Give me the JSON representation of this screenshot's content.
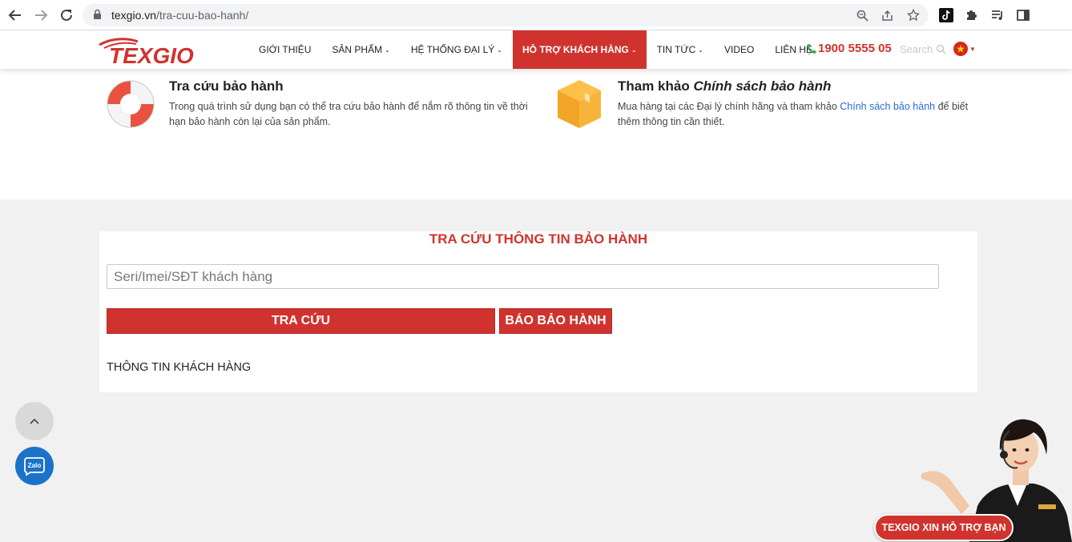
{
  "browser": {
    "url_domain": "texgio.vn",
    "url_path": "/tra-cuu-bao-hanh/"
  },
  "header": {
    "logo_text": "TEXGIO",
    "menu": [
      {
        "label": "GIỚI THIỆU",
        "has_dropdown": false,
        "active": false
      },
      {
        "label": "SẢN PHẨM",
        "has_dropdown": true,
        "active": false
      },
      {
        "label": "HỆ THỐNG ĐẠI LÝ",
        "has_dropdown": true,
        "active": false
      },
      {
        "label": "HỖ TRỢ KHÁCH HÀNG",
        "has_dropdown": true,
        "active": true
      },
      {
        "label": "TIN TỨC",
        "has_dropdown": true,
        "active": false
      },
      {
        "label": "VIDEO",
        "has_dropdown": false,
        "active": false
      },
      {
        "label": "LIÊN HỆ",
        "has_dropdown": false,
        "active": false
      }
    ],
    "hotline": "1900 5555 05",
    "search_placeholder": "Search"
  },
  "info": {
    "lookup": {
      "title": "Tra cứu bảo hành",
      "description": "Trong quá trình sử dụng bạn có thể tra cứu bảo hành để nắm rõ thông tin về thời hạn bảo hành còn lại của sản phẩm."
    },
    "policy": {
      "title_prefix": "Tham khảo ",
      "title_italic": "Chính sách bảo hành",
      "description_before": "Mua hàng tại các Đại lý chính hãng và tham khảo ",
      "description_link": "Chính sách bảo hành",
      "description_after": " để biết thêm thông tin cần thiết."
    }
  },
  "form": {
    "title": "TRA CỨU THÔNG TIN BẢO HÀNH",
    "input_placeholder": "Seri/Imei/SĐT khách hàng",
    "input_value": "",
    "lookup_button": "TRA CỨU",
    "report_button": "BÁO BẢO HÀNH",
    "customer_info_label": "THÔNG TIN KHÁCH HÀNG"
  },
  "widgets": {
    "zalo_label": "Zalo",
    "support_banner": "TEXGIO XIN HỖ TRỢ BẠN"
  },
  "colors": {
    "brand_red": "#d0332e",
    "link_blue": "#2a6bd4",
    "zalo_blue": "#1b73c9"
  }
}
